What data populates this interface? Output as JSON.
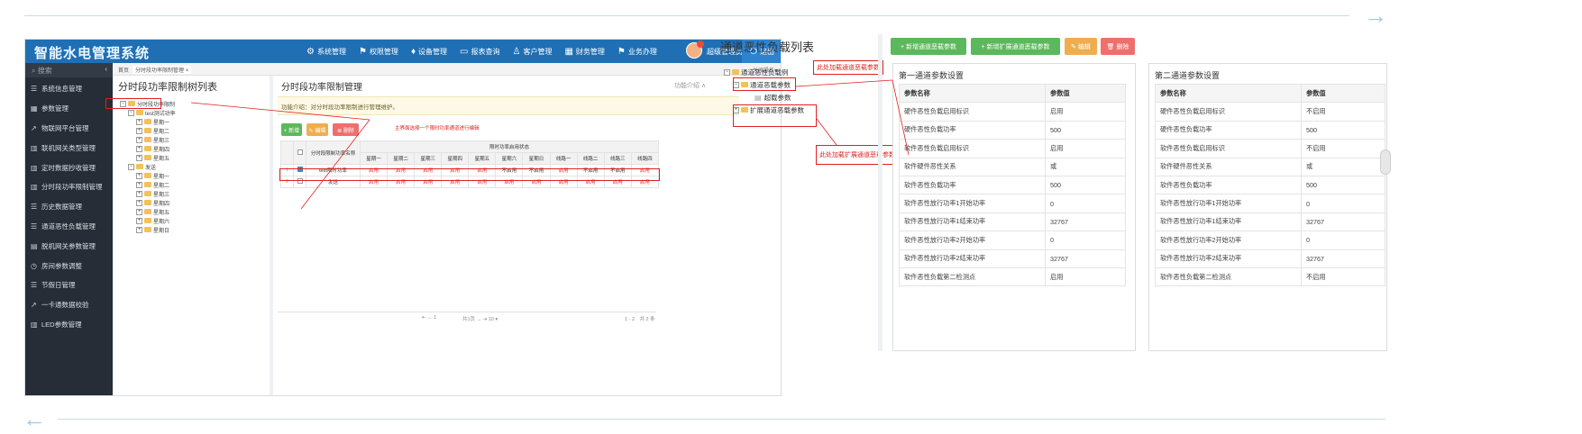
{
  "app": {
    "title": "智能水电管理系统",
    "nav": [
      {
        "icon": "gear-icon",
        "glyph": "⚙",
        "label": "系统管理"
      },
      {
        "icon": "flag-icon",
        "glyph": "⚑",
        "label": "权限管理"
      },
      {
        "icon": "device-icon",
        "glyph": "♦",
        "label": "设备管理"
      },
      {
        "icon": "monitor-icon",
        "glyph": "▭",
        "label": "报表查询"
      },
      {
        "icon": "users-icon",
        "glyph": "♙",
        "label": "客户管理"
      },
      {
        "icon": "bank-icon",
        "glyph": "▦",
        "label": "财务管理"
      },
      {
        "icon": "office-icon",
        "glyph": "⚑",
        "label": "业务办理"
      }
    ],
    "user": "超级管理员",
    "logout": "退出",
    "search_placeholder": "搜索",
    "sidebar": [
      {
        "icon": "list-icon",
        "glyph": "☰",
        "label": "系统信息管理"
      },
      {
        "icon": "grid-icon",
        "glyph": "▦",
        "label": "参数管理"
      },
      {
        "icon": "chart-icon",
        "glyph": "↗",
        "label": "物联网平台管理"
      },
      {
        "icon": "bar-chart-icon",
        "glyph": "▥",
        "label": "联机网关类型管理"
      },
      {
        "icon": "bar-chart-icon",
        "glyph": "▥",
        "label": "定时数据抄收管理"
      },
      {
        "icon": "bar-chart-icon",
        "glyph": "▥",
        "label": "分时段功率限制管理"
      },
      {
        "icon": "list-icon",
        "glyph": "☰",
        "label": "历史数据管理"
      },
      {
        "icon": "list-icon",
        "glyph": "☰",
        "label": "通道恶性负载管理"
      },
      {
        "icon": "doc-icon",
        "glyph": "▤",
        "label": "脱机网关参数管理"
      },
      {
        "icon": "clock-icon",
        "glyph": "◷",
        "label": "房间参数调整"
      },
      {
        "icon": "list-icon",
        "glyph": "☰",
        "label": "节假日管理"
      },
      {
        "icon": "chart-icon",
        "glyph": "↗",
        "label": "一卡通数据校验"
      },
      {
        "icon": "bar-chart-icon",
        "glyph": "▥",
        "label": "LED参数管理"
      }
    ],
    "tabs": {
      "home": "首页",
      "current": "分时段功率限制管理",
      "right": "关闭操作▾"
    },
    "left_panel": {
      "title": "分时段功率限制树列表",
      "root": "分时段功率限制",
      "groups": [
        {
          "label": "test测试功率",
          "children": [
            "星期一",
            "星期二",
            "星期三",
            "星期四",
            "星期五"
          ]
        },
        {
          "label": "发送",
          "children": [
            "星期一",
            "星期二",
            "星期三",
            "星期四",
            "星期五",
            "星期六",
            "星期日"
          ]
        }
      ]
    },
    "main_panel": {
      "title": "分时段功率限制管理",
      "help": "功能介绍 ∧",
      "intro": "功能介绍：对分时段功率限制进行管理维护。",
      "buttons": {
        "add": "+ 新增",
        "edit": "✎ 编辑",
        "del": "⊗ 删除"
      },
      "annotation": "主界面选择一个限时功率通道进行编辑",
      "table": {
        "col_name": "分时段限制功率名称",
        "group_header": "限时功率启用状态",
        "cols": [
          "星期一",
          "星期二",
          "星期三",
          "星期四",
          "星期五",
          "星期六",
          "星期日",
          "线路一",
          "线路二",
          "线路三",
          "线路四"
        ],
        "rows": [
          {
            "num": "1",
            "name": "test限时功率",
            "checked": true,
            "vals": [
              "启用",
              "启用",
              "启用",
              "启用",
              "启用",
              "不启用",
              "不启用",
              "启用",
              "不启用",
              "不启用",
              "启用"
            ]
          },
          {
            "num": "2",
            "name": "发送",
            "checked": false,
            "vals": [
              "启用",
              "启用",
              "启用",
              "启用",
              "启用",
              "启用",
              "启用",
              "启用",
              "启用",
              "启用",
              "启用"
            ]
          }
        ]
      },
      "pager": {
        "nav": "⇤ ← 1",
        "page": "共1页 → ⇥ 10 ▾",
        "count": "1 - 2　共 2 条"
      }
    }
  },
  "right": {
    "tree_title": "通道恶性负载列表",
    "tree": {
      "root": "通道恶性负载例",
      "child1": "通道恶载参数",
      "leaf": "超载参数",
      "child2": "扩展通道恶载参数"
    },
    "buttons": [
      {
        "label": "+ 新增通道恶载参数",
        "color": "#5cb85c"
      },
      {
        "label": "+ 新增扩展通道恶载参数",
        "color": "#5cb85c"
      },
      {
        "label": "✎ 编辑",
        "color": "#f0ad4e"
      },
      {
        "label": "🗑 删除",
        "color": "#ef6f6c"
      }
    ],
    "callouts": {
      "top": "此处加载通道恶载参数",
      "bottom": "此处加载扩展通道恶载参数"
    },
    "cards": [
      {
        "title": "第一通道参数设置",
        "head": [
          "参数名称",
          "参数值"
        ],
        "rows": [
          [
            "硬件恶性负载启用标识",
            "启用"
          ],
          [
            "硬件恶性负载功率",
            "500"
          ],
          [
            "软件恶性负载启用标识",
            "启用"
          ],
          [
            "软件硬件恶性关系",
            "或"
          ],
          [
            "软件恶性负载功率",
            "500"
          ],
          [
            "软件恶性放行功率1开始功率",
            "0"
          ],
          [
            "软件恶性放行功率1结束功率",
            "32767"
          ],
          [
            "软件恶性放行功率2开始功率",
            "0"
          ],
          [
            "软件恶性放行功率2结束功率",
            "32767"
          ],
          [
            "软件恶性负载第二检测点",
            "启用"
          ]
        ]
      },
      {
        "title": "第二通道参数设置",
        "head": [
          "参数名称",
          "参数值"
        ],
        "rows": [
          [
            "硬件恶性负载启用标识",
            "不启用"
          ],
          [
            "硬件恶性负载功率",
            "500"
          ],
          [
            "软件恶性负载启用标识",
            "不启用"
          ],
          [
            "软件硬件恶性关系",
            "或"
          ],
          [
            "软件恶性负载功率",
            "500"
          ],
          [
            "软件恶性放行功率1开始功率",
            "0"
          ],
          [
            "软件恶性放行功率1结束功率",
            "32767"
          ],
          [
            "软件恶性放行功率2开始功率",
            "0"
          ],
          [
            "软件恶性放行功率2结束功率",
            "32767"
          ],
          [
            "软件恶性负载第二检测点",
            "不启用"
          ]
        ]
      }
    ]
  }
}
